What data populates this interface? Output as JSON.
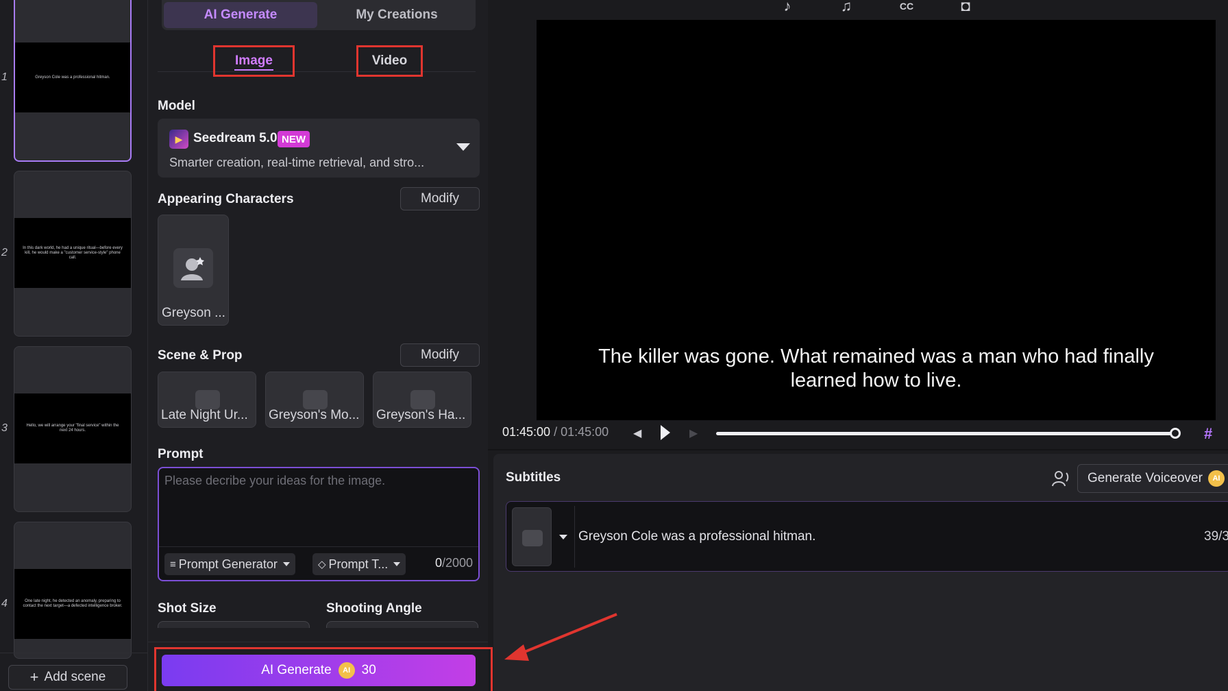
{
  "scenes": [
    {
      "number": "1",
      "caption": "Greyson Cole was a professional hitman."
    },
    {
      "number": "2",
      "caption": "In this dark world, he had a unique ritual—before every kill, he would make a \"customer service-style\" phone call."
    },
    {
      "number": "3",
      "caption": "Hello, we will arrange your \"final service\" within the next 24 hours."
    },
    {
      "number": "4",
      "caption": "One late night, he detected an anomaly, preparing to contact the next target—a defected intelligence broker."
    }
  ],
  "add_scene_label": "Add scene",
  "mode_tabs": {
    "ai_generate": "AI Generate",
    "my_creations": "My Creations"
  },
  "type_tabs": {
    "image": "Image",
    "video": "Video"
  },
  "model": {
    "section_label": "Model",
    "name": "Seedream 5.0",
    "badge": "NEW",
    "description": "Smarter creation, real-time retrieval, and stro..."
  },
  "characters": {
    "section_label": "Appearing Characters",
    "modify_label": "Modify",
    "items": [
      {
        "name": "Greyson ..."
      }
    ]
  },
  "scene_prop": {
    "section_label": "Scene & Prop",
    "modify_label": "Modify",
    "items": [
      {
        "name": "Late Night Ur..."
      },
      {
        "name": "Greyson's Mo..."
      },
      {
        "name": "Greyson's Ha..."
      }
    ]
  },
  "prompt": {
    "section_label": "Prompt",
    "placeholder": "Please decribe your ideas for the image.",
    "generator_label": "Prompt Generator",
    "template_label": "Prompt T...",
    "count_current": "0",
    "count_max": "/2000"
  },
  "shot_size_label": "Shot Size",
  "shooting_angle_label": "Shooting Angle",
  "generate": {
    "label": "AI Generate",
    "cost": "30",
    "coin": "AI"
  },
  "preview": {
    "subtitle": "The killer was gone. What remained was a man who had finally learned how to live.",
    "current_time": "01:45:00",
    "duration": "/ 01:45:00",
    "progress": 1.0
  },
  "subtitles": {
    "title": "Subtitles",
    "voiceover_label": "Generate Voiceover",
    "rows": [
      {
        "text": "Greyson Cole was a professional hitman.",
        "count": "39/3"
      }
    ]
  },
  "colors": {
    "accent": "#c77dff",
    "highlight": "#e0352f",
    "generate_start": "#7a3cf0",
    "generate_end": "#c33ee6"
  }
}
